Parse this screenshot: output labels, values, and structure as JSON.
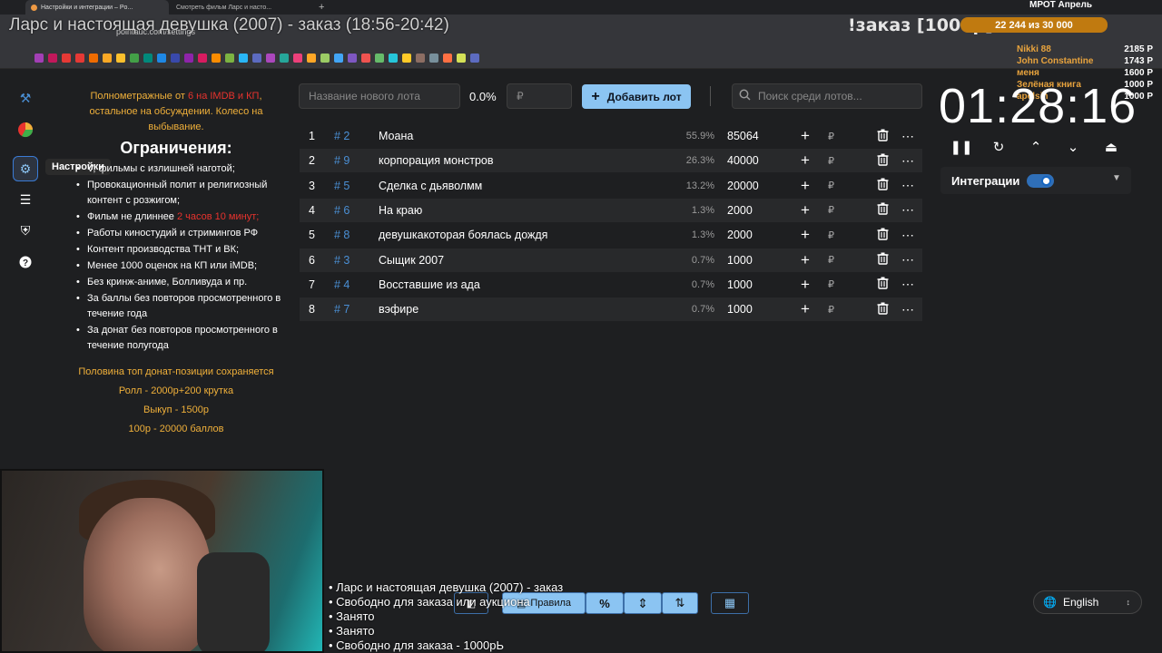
{
  "browser": {
    "tabs": [
      {
        "label": "Настройки и интеграции – Po..."
      },
      {
        "label": "Смотреть фильм Ларс и насто..."
      }
    ],
    "url": "pointauc.com/settings"
  },
  "stream_overlay": {
    "title": "Ларс и настоящая девушка (2007) - заказ (18:56-20:42)",
    "order_label": "!заказ [1000р]",
    "mrot_label": "МРОТ Апрель",
    "progress_text": "22 244 из 30 000",
    "progress_fraction": 0.741,
    "donors": [
      {
        "name": "Nikki 88",
        "amount": "2185 Р"
      },
      {
        "name": "John Constantine",
        "amount": "1743 Р"
      },
      {
        "name": "меня",
        "amount": "1600 Р"
      },
      {
        "name": "Зелёная книга",
        "amount": "1000 Р"
      },
      {
        "name": "apelsin",
        "amount": "1000 Р"
      }
    ],
    "tickers": [
      "• Ларс и настоящая девушка (2007) - заказ",
      "• Свободно для заказа или аукциона",
      "• Занято",
      "• Занято",
      "• Свободно для заказа - 1000рЬ"
    ]
  },
  "sidebar": {
    "items": [
      {
        "icon": "hammer-icon"
      },
      {
        "icon": "wheel-icon"
      },
      {
        "icon": "settings-icon",
        "selected": true
      },
      {
        "icon": "layers-icon"
      },
      {
        "icon": "shield-icon"
      },
      {
        "icon": "help-icon"
      }
    ],
    "tooltip": "Настройки"
  },
  "rules": {
    "intro_a": "Полнометражные от ",
    "intro_red": "6 на IMDB и КП",
    "intro_b": ", остальное на обсуждении. Колесо на выбывание.",
    "heading": "Ограничения:",
    "items": [
      "V, фильмы с излишней наготой;",
      "Провокационный полит и религиозный контент с розжигом;",
      "Фильм не длиннее ",
      "Работы киностудий и стримингов РФ",
      "Контент производства ТНТ и ВК;",
      "Менее 1000 оценок на КП или iMDB;",
      "Без кринж-аниме, Болливуда и пр.",
      "За баллы без повторов просмотренного в течение года",
      "За донат без повторов просмотренного в течение полугода"
    ],
    "length_limit": "2 часов 10 минут;",
    "footer": [
      "Половина топ донат-позиции сохраняется",
      "Ролл - 2000р+200 крутка",
      "Выкуп - 1500р",
      "100р - 20000 баллов"
    ]
  },
  "controls": {
    "new_lot_placeholder": "Название нового лота",
    "percent": "0.0%",
    "amount_placeholder": "₽",
    "add_button": "Добавить лот",
    "search_placeholder": "Поиск среди лотов..."
  },
  "lots": [
    {
      "idx": "1",
      "id": "# 2",
      "name": "Моана",
      "pct": "55.9%",
      "amount": "85064"
    },
    {
      "idx": "2",
      "id": "# 9",
      "name": "корпорация монстров",
      "pct": "26.3%",
      "amount": "40000"
    },
    {
      "idx": "3",
      "id": "# 5",
      "name": "Сделка с дьяволмм",
      "pct": "13.2%",
      "amount": "20000"
    },
    {
      "idx": "4",
      "id": "# 6",
      "name": "На краю",
      "pct": "1.3%",
      "amount": "2000"
    },
    {
      "idx": "5",
      "id": "# 8",
      "name": "девушкакоторая боялась дождя",
      "pct": "1.3%",
      "amount": "2000"
    },
    {
      "idx": "6",
      "id": "# 3",
      "name": "Сыщик 2007",
      "pct": "0.7%",
      "amount": "1000"
    },
    {
      "idx": "7",
      "id": "# 4",
      "name": "Восставшие из ада",
      "pct": "0.7%",
      "amount": "1000"
    },
    {
      "idx": "8",
      "id": "# 7",
      "name": "вэфире",
      "pct": "0.7%",
      "amount": "1000"
    }
  ],
  "lot_currency": "₽",
  "timer": {
    "value": "01:28:16"
  },
  "integrations": {
    "label": "Интеграции",
    "enabled": true
  },
  "bottom_bar": {
    "rules_button": "Правила",
    "percent_button": "%"
  },
  "language": {
    "selected": "English"
  },
  "colors": {
    "accent": "#8bc4f2",
    "orange": "#f0b03a",
    "red": "#e8332e",
    "id_blue": "#4a8fd4"
  }
}
